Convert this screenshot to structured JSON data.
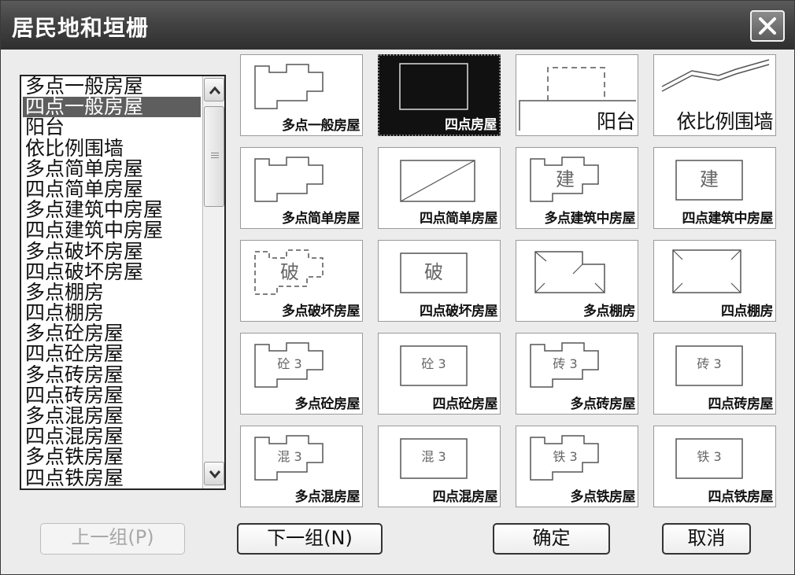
{
  "window": {
    "title": "居民地和垣栅"
  },
  "list": {
    "items": [
      "多点一般房屋",
      "四点一般房屋",
      "阳台",
      "依比例围墙",
      "多点简单房屋",
      "四点简单房屋",
      "多点建筑中房屋",
      "四点建筑中房屋",
      "多点破坏房屋",
      "四点破坏房屋",
      "多点棚房",
      "四点棚房",
      "多点砼房屋",
      "四点砼房屋",
      "多点砖房屋",
      "四点砖房屋",
      "多点混房屋",
      "四点混房屋",
      "多点铁房屋",
      "四点铁房屋"
    ],
    "selected": "四点一般房屋"
  },
  "symbols": [
    {
      "label": "多点一般房屋",
      "shape": "multi",
      "text": ""
    },
    {
      "label": "四点房屋",
      "shape": "rect-selected",
      "text": ""
    },
    {
      "label": "阳台",
      "shape": "balcony",
      "text": ""
    },
    {
      "label": "依比例围墙",
      "shape": "wall",
      "text": ""
    },
    {
      "label": "多点简单房屋",
      "shape": "multi",
      "text": ""
    },
    {
      "label": "四点简单房屋",
      "shape": "rect-diag",
      "text": ""
    },
    {
      "label": "多点建筑中房屋",
      "shape": "multi",
      "text": "建"
    },
    {
      "label": "四点建筑中房屋",
      "shape": "rect",
      "text": "建"
    },
    {
      "label": "多点破坏房屋",
      "shape": "multi-dashed",
      "text": "破"
    },
    {
      "label": "四点破坏房屋",
      "shape": "rect",
      "text": "破"
    },
    {
      "label": "多点棚房",
      "shape": "shed-multi",
      "text": ""
    },
    {
      "label": "四点棚房",
      "shape": "shed-rect",
      "text": ""
    },
    {
      "label": "多点砼房屋",
      "shape": "multi",
      "text": "砼 3"
    },
    {
      "label": "四点砼房屋",
      "shape": "rect",
      "text": "砼 3"
    },
    {
      "label": "多点砖房屋",
      "shape": "multi",
      "text": "砖 3"
    },
    {
      "label": "四点砖房屋",
      "shape": "rect",
      "text": "砖 3"
    },
    {
      "label": "多点混房屋",
      "shape": "multi",
      "text": "混 3"
    },
    {
      "label": "四点混房屋",
      "shape": "rect",
      "text": "混 3"
    },
    {
      "label": "多点铁房屋",
      "shape": "multi",
      "text": "铁 3"
    },
    {
      "label": "四点铁房屋",
      "shape": "rect",
      "text": "铁 3"
    }
  ],
  "buttons": {
    "prev": "上一组(P)",
    "next": "下一组(N)",
    "ok": "确定",
    "cancel": "取消"
  },
  "icons": {
    "close": "close-icon",
    "scroll_up": "chevron-up-icon",
    "scroll_down": "chevron-down-icon"
  }
}
